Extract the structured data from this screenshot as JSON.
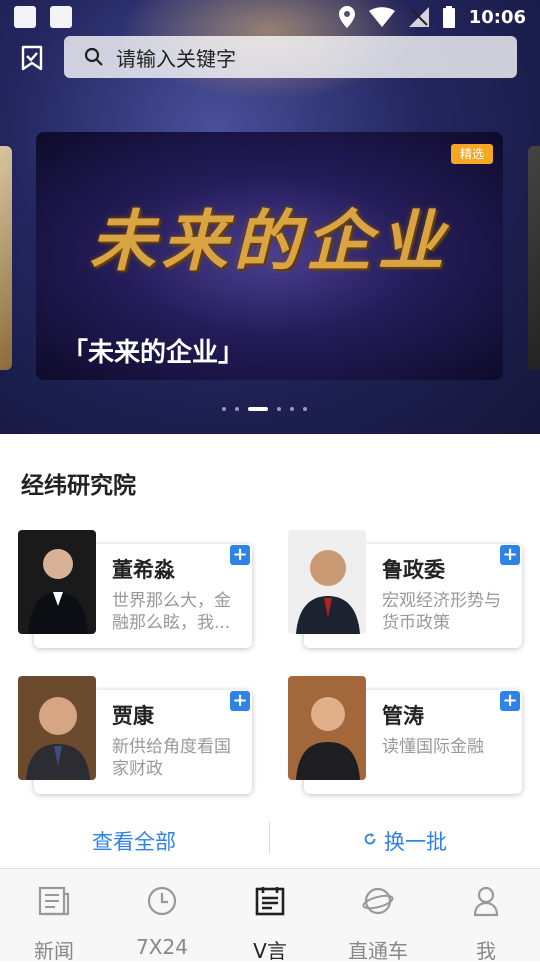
{
  "status_bar": {
    "time": "10:06"
  },
  "search": {
    "placeholder": "请输入关键字"
  },
  "banner": {
    "art_title": "未来的企业",
    "caption": "「未来的企业」",
    "badge": "精选",
    "page_count": 6,
    "active_page": 3
  },
  "section": {
    "title": "经纬研究院",
    "experts": [
      {
        "name": "董希淼",
        "desc": "世界那么大，金融那么眩，我..."
      },
      {
        "name": "鲁政委",
        "desc": "宏观经济形势与货币政策"
      },
      {
        "name": "贾康",
        "desc": "新供给角度看国家财政"
      },
      {
        "name": "管涛",
        "desc": "读懂国际金融"
      }
    ],
    "view_all": "查看全部",
    "refresh": "换一批"
  },
  "tabs": [
    {
      "label": "新闻",
      "icon": "news-icon"
    },
    {
      "label": "7X24",
      "icon": "clock-icon"
    },
    {
      "label": "V言",
      "icon": "v-opinion-icon",
      "active": true
    },
    {
      "label": "直通车",
      "icon": "planet-icon"
    },
    {
      "label": "我",
      "icon": "profile-icon"
    }
  ],
  "colors": {
    "accent": "#2f82e6",
    "badge": "#f5a623"
  }
}
